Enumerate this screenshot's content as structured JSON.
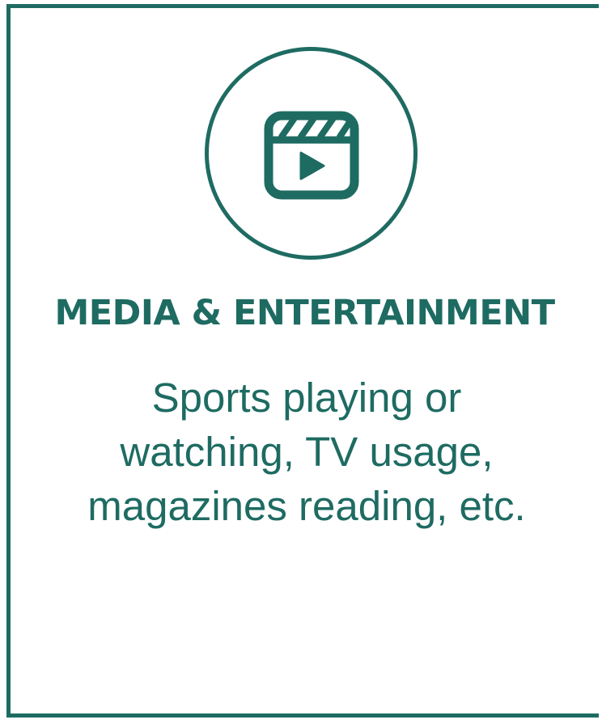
{
  "card": {
    "icon": "video-clapperboard-icon",
    "title": "MEDIA & ENTERTAINMENT",
    "description_lines": [
      "Sports playing or",
      "watching, TV usage,",
      "magazines reading, etc."
    ]
  },
  "colors": {
    "accent": "#1e6b62",
    "background": "#ffffff"
  }
}
